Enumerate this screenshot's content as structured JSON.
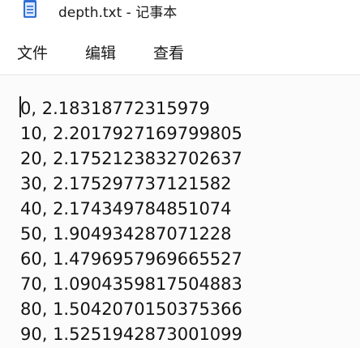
{
  "window": {
    "title": "depth.txt - 记事本",
    "app_icon": "notepad-icon"
  },
  "menu": {
    "file": "文件",
    "edit": "编辑",
    "view": "查看"
  },
  "editor": {
    "lines": [
      "0, 2.18318772315979",
      "10, 2.2017927169799805",
      "20, 2.1752123832702637",
      "30, 2.175297737121582",
      "40, 2.174349784851074",
      "50, 1.904934287071228",
      "60, 1.4796957969665527",
      "70, 1.0904359817504883",
      "80, 1.5042070150375366",
      "90, 1.5251942873001099"
    ]
  },
  "colors": {
    "icon_blue": "#2f6fd6",
    "icon_light": "#dce8fb",
    "editor_bg": "#fbfbfb",
    "text": "#141414"
  }
}
